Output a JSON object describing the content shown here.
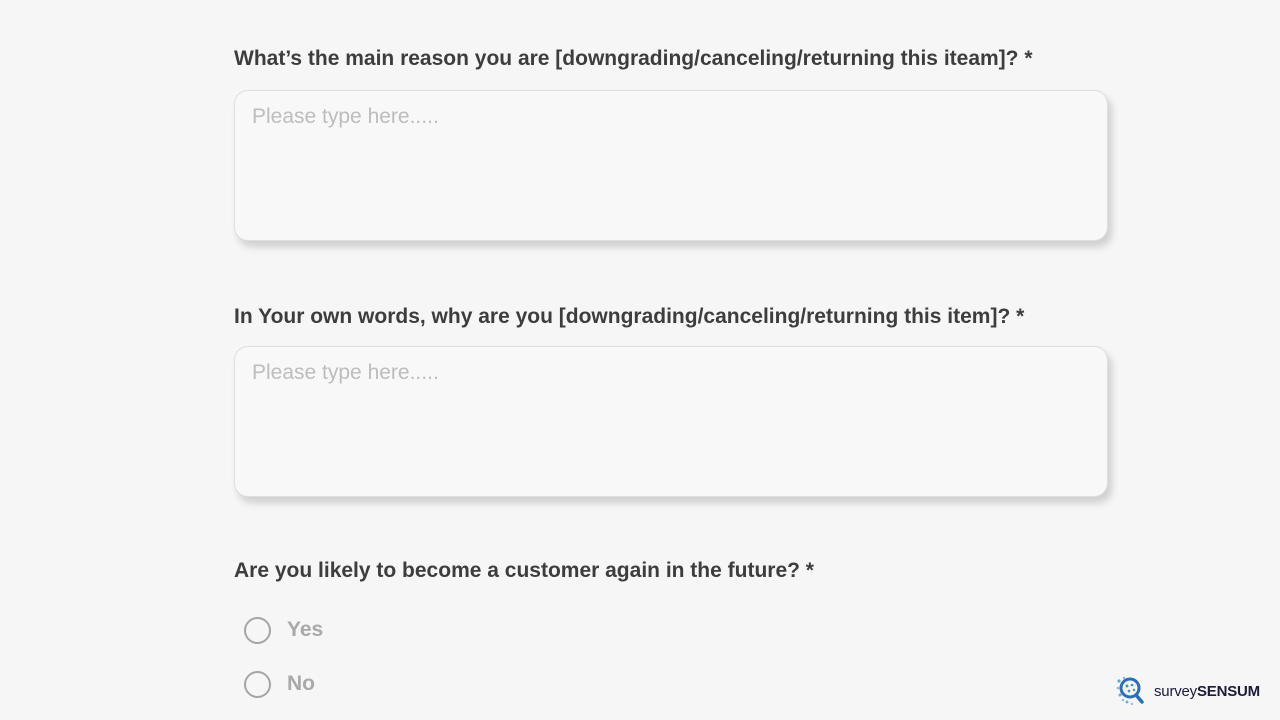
{
  "questions": [
    {
      "text": "What’s the main reason you are [downgrading/canceling/returning this iteam]? *",
      "placeholder": "Please type here....."
    },
    {
      "text": "In Your own words, why are you [downgrading/canceling/returning this item]? *",
      "placeholder": "Please type here....."
    },
    {
      "text": "Are you likely to become a customer again in the future? *",
      "options": [
        "Yes",
        "No"
      ],
      "selected": null
    }
  ],
  "logo": {
    "icon": "magnifier-dots-icon",
    "part1": "survey",
    "part2": "SENSUM",
    "accent_color": "#2b6fb6"
  }
}
